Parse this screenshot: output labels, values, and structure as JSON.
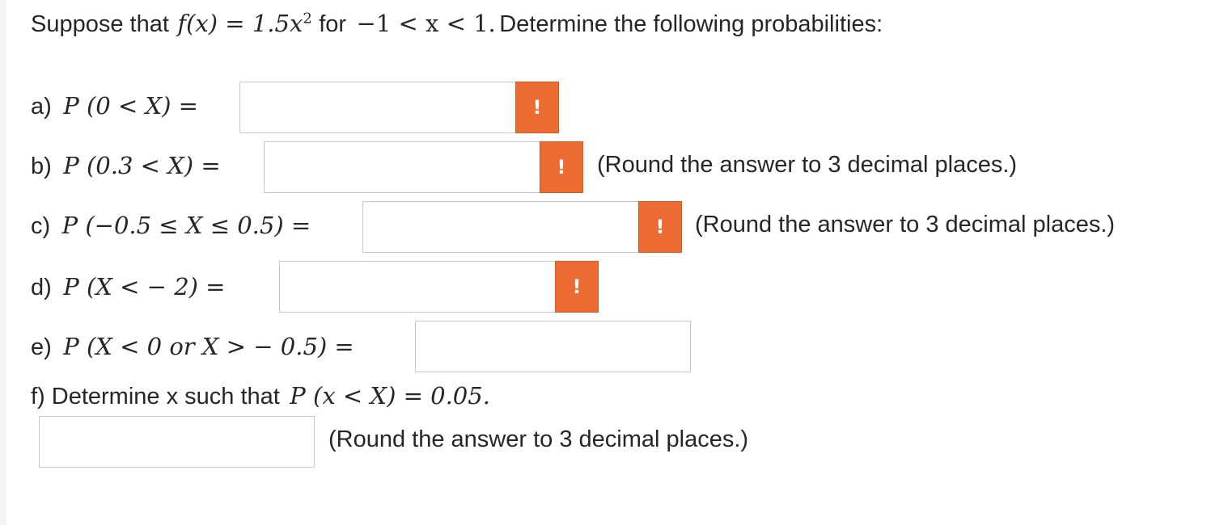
{
  "question": {
    "intro_text": "Suppose that",
    "function_expr": "f(x) = 1.5x",
    "exponent": "2",
    "for_text": "for",
    "domain_expr": "−1 < x < 1.",
    "rest_text": "Determine the following probabilities:"
  },
  "parts": {
    "a": {
      "label": "a)",
      "expr": "P (0 < X) ="
    },
    "b": {
      "label": "b)",
      "expr": "P (0.3 < X) =",
      "note": "(Round the answer to 3 decimal places.)"
    },
    "c": {
      "label": "c)",
      "expr": "P (−0.5 ≤ X ≤ 0.5) =",
      "note": "(Round the answer to 3 decimal places.)"
    },
    "d": {
      "label": "d)",
      "expr": "P (X < − 2) ="
    },
    "e": {
      "label": "e)",
      "expr": "P (X < 0 or X > − 0.5) ="
    },
    "f": {
      "text": "f) Determine x such that",
      "expr": "P (x < X) = 0.05.",
      "note": "(Round the answer to 3 decimal places.)"
    }
  },
  "warning_glyph": "!",
  "colors": {
    "warning_bg": "#ee6a33",
    "input_border": "#c9c9c9"
  }
}
